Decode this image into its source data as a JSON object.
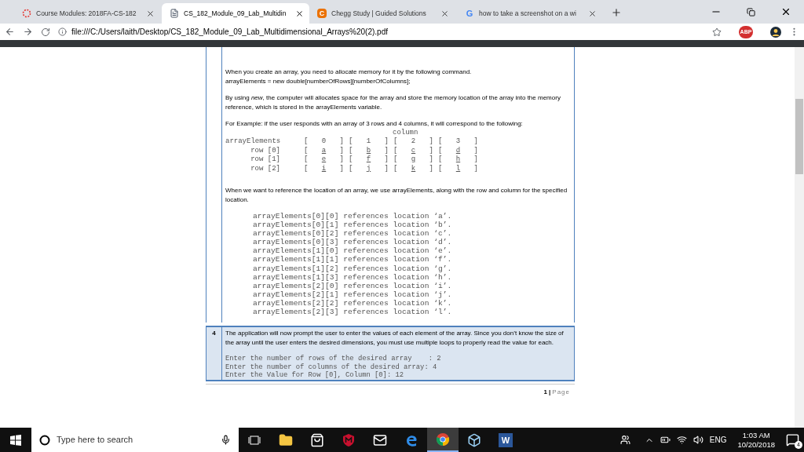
{
  "browser": {
    "tabs": [
      {
        "kind": "loading",
        "title": "Course Modules: 2018FA-CS-182",
        "selected": false
      },
      {
        "kind": "document",
        "title": "CS_182_Module_09_Lab_Multidin",
        "selected": true
      },
      {
        "kind": "chegg",
        "logo": "C",
        "title": "Chegg Study | Guided Solutions",
        "selected": false
      },
      {
        "kind": "google",
        "logo": "G",
        "title": "how to take a screenshot on a wi",
        "selected": false
      }
    ],
    "address": "file:///C:/Users/laith/Desktop/CS_182_Module_09_Lab_Multidimensional_Arrays%20(2).pdf",
    "adblock_label": "ABP"
  },
  "document": {
    "rows": [
      {
        "highlighted": false,
        "blocks": [
          {
            "kind": "text",
            "lines": [
              "When you create an array, you need to allocate memory for it by the following command.",
              "arrayElements = new double[numberOfRows][numberOfColumns];"
            ]
          },
          {
            "kind": "text",
            "lines": [
              "By using *new*, the computer will allocates space for the array and store the memory location of the array into the memory reference, which is stored in the arrayElements variable."
            ]
          },
          {
            "kind": "text",
            "lines": [
              "For Example: if the user responds with an array of 3 rows and 4 columns, it will correspond to the following:"
            ]
          },
          {
            "kind": "array_diagram",
            "column_label": "column",
            "open": "[",
            "close": "]",
            "header": {
              "label": "arrayElements",
              "cells": [
                "0",
                "1",
                "2",
                "3"
              ]
            },
            "rows": [
              {
                "label": "row [0]",
                "cells": [
                  "a",
                  "b",
                  "c",
                  "d"
                ]
              },
              {
                "label": "row [1]",
                "cells": [
                  "e",
                  "f",
                  "g",
                  "h"
                ]
              },
              {
                "label": "row [2]",
                "cells": [
                  "i",
                  "j",
                  "k",
                  "l"
                ]
              }
            ]
          },
          {
            "kind": "text",
            "lines": [
              "When we want to reference the location of an array, we use arrayElements, along with the row and column for the specified location."
            ]
          },
          {
            "kind": "code",
            "lines": [
              "arrayElements[0][0] references location ‘a’.",
              "arrayElements[0][1] references location ‘b’.",
              "arrayElements[0][2] references location ‘c’.",
              "arrayElements[0][3] references location ‘d’.",
              "arrayElements[1][0] references location ‘e’.",
              "arrayElements[1][1] references location ‘f’.",
              "arrayElements[1][2] references location ‘g’.",
              "arrayElements[1][3] references location ‘h’.",
              "arrayElements[2][0] references location ‘i’.",
              "arrayElements[2][1] references location ‘j’.",
              "arrayElements[2][2] references location ‘k’.",
              "arrayElements[2][3] references location ‘l’."
            ]
          }
        ]
      },
      {
        "number": "4",
        "highlighted": true,
        "blocks": [
          {
            "kind": "text",
            "lines": [
              "The application will now prompt the user to enter the values of each element of the array.  Since you don’t know the size of the array until the user enters the desired dimensions, you must use multiple loops to properly read the value for each."
            ]
          },
          {
            "kind": "console",
            "lines": [
              "Enter the number of rows of the desired array    : 2",
              "Enter the number of columns of the desired array: 4",
              "Enter the Value for Row [0], Column [0]: 12"
            ]
          }
        ]
      }
    ],
    "footer": {
      "number": "1",
      "separator": "|",
      "label": "Page"
    }
  },
  "taskbar": {
    "search_placeholder": "Type here to search",
    "apps": [
      {
        "kind": "folder",
        "selected": false
      },
      {
        "kind": "store",
        "selected": false
      },
      {
        "kind": "shield",
        "selected": false
      },
      {
        "kind": "mail",
        "selected": false
      },
      {
        "kind": "edge",
        "selected": false
      },
      {
        "kind": "chrome",
        "selected": true
      },
      {
        "kind": "cube",
        "selected": false
      },
      {
        "kind": "word",
        "logo": "W",
        "selected": false
      }
    ],
    "language": "ENG",
    "time": "1:03 AM",
    "date": "10/20/2018",
    "notifications": "4"
  }
}
